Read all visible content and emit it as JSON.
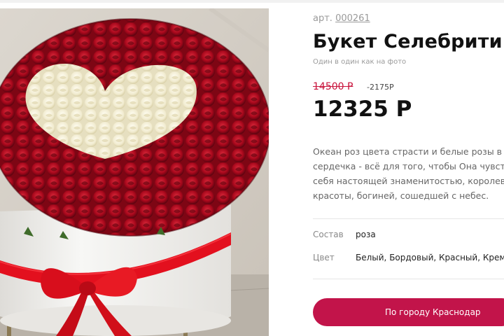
{
  "product": {
    "sku_prefix": "арт.",
    "sku_code": "000261",
    "title": "Букет Селебрити",
    "subtitle": "Один в один как на фото",
    "old_price": "14500 Р",
    "discount": "-2175Р",
    "price": "12325 Р",
    "description_lines": [
      "Океан роз цвета страсти и белые розы в",
      "сердечка - всё для того, чтобы Она чувств",
      "себя настоящей знаменитостью, королевой",
      "красоты, богиней, сошедшей с небес."
    ],
    "attributes": [
      {
        "label": "Состав",
        "value": "роза"
      },
      {
        "label": "Цвет",
        "value": "Белый, Бордовый, Красный, Кремовы"
      }
    ],
    "delivery_button": "По городу Краснодар",
    "image": {
      "subject": "bouquet-of-red-and-white-roses-heart-in-hatbox",
      "colors": {
        "red_roses": "#a8081c",
        "white_roses": "#f4f0dc",
        "box": "#f3f3f1",
        "ribbon": "#e3101e"
      }
    },
    "colors": {
      "accent": "#c2144a",
      "old_price": "#c8143c"
    }
  }
}
